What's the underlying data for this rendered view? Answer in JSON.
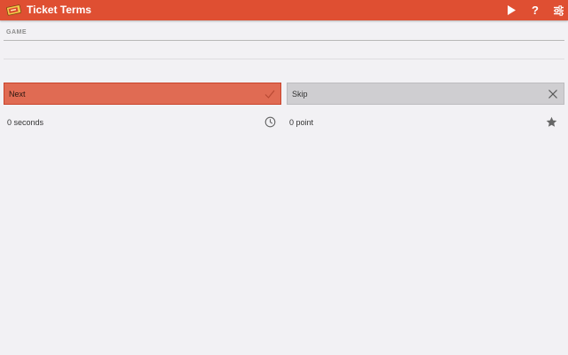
{
  "app": {
    "title": "Ticket Terms",
    "colors": {
      "action_bar": "#df4f32",
      "next_button": "#e06b53",
      "skip_button": "#cfced1",
      "background": "#f2f1f4"
    },
    "icons": {
      "app": "ticket-icon",
      "play": "play-icon",
      "help": "help-icon",
      "settings": "settings-sliders-icon",
      "next": "check-icon",
      "skip": "close-icon",
      "time": "clock-icon",
      "points": "star-icon"
    }
  },
  "action_bar": {
    "help_label": "?"
  },
  "game": {
    "section_title": "GAME",
    "term": "",
    "next_label": "Next",
    "skip_label": "Skip",
    "time_text": "0 seconds",
    "points_text": "0 point"
  }
}
